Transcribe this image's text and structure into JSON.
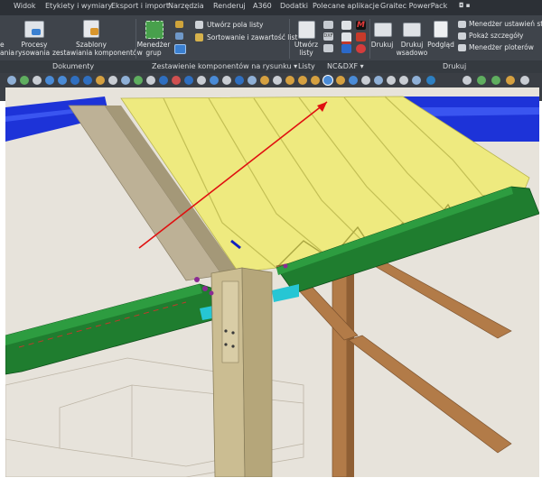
{
  "ribbon": {
    "tabs": [
      "Widok",
      "Etykiety i wymiary",
      "Eksport i import",
      "Narzędzia",
      "Renderuj",
      "A360",
      "Dodatki",
      "Polecane aplikacje",
      "Graitec PowerPack"
    ],
    "dropdown_glyph": "◘ ▪",
    "buttons": {
      "left_cut_1": "e",
      "left_cut_2": "ania",
      "procesy_1": "Procesy",
      "procesy_2": "rysowania",
      "szablony_1": "Szablony",
      "szablony_2": "zestawiania komponentów",
      "menedzer_grup_1": "Menedżer",
      "menedzer_grup_2": "grup",
      "utworz_pola_listy": "Utwórz pola listy",
      "sortowanie": "Sortowanie i zawartość list",
      "utworz_listy_1": "Utwórz",
      "utworz_listy_2": "listy",
      "drukuj": "Drukuj",
      "drukuj_wsadowo_1": "Drukuj",
      "drukuj_wsadowo_2": "wsadowo",
      "podglad": "Podgląd",
      "menedzer_ustawien": "Menedżer ustawień str",
      "pokaz_szczegoly": "Pokaż szczegóły",
      "menedzer_ploterow": "Menedżer ploterów"
    },
    "panels": {
      "dokumenty": "Dokumenty",
      "zestawienie": "Zestawienie komponentów na rysunku ▾",
      "listy": "Listy",
      "nc_dxf": "NC&DXF ▾",
      "drukuj": "Drukuj"
    },
    "small_icon_text": {
      "m": "M",
      "dxf": "DXF"
    },
    "colors": {
      "ribbon_bg": "#3f444b",
      "tab_bg": "#2c3036",
      "text": "#e6e8ea"
    }
  },
  "viewport": {
    "colors": {
      "sky": "#e7e3db",
      "roof_blue": "#1a2fd6",
      "deck_yellow": "#e9e77a",
      "beam_green": "#1d7a2c",
      "column": "#c9b98e",
      "timber": "#b07a47",
      "arrow": "#e01010"
    }
  }
}
